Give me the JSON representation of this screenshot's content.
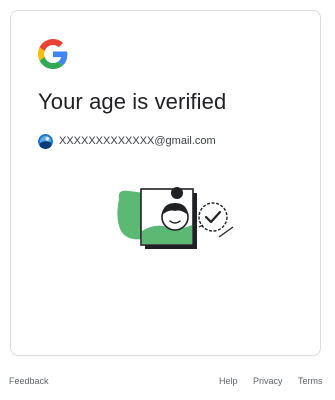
{
  "page": {
    "title": "Your age is verified"
  },
  "account": {
    "email": "XXXXXXXXXXXXX@gmail.com"
  },
  "footer": {
    "feedback": "Feedback",
    "help": "Help",
    "privacy": "Privacy",
    "terms": "Terms"
  },
  "icons": {
    "logo": "google-g-logo",
    "avatar": "account-avatar",
    "illustration": "age-verified-illustration"
  },
  "colors": {
    "google_blue": "#4285F4",
    "google_red": "#EA4335",
    "google_yellow": "#FBBC05",
    "google_green": "#34A853",
    "illustration_green": "#5bb974",
    "text_primary": "#202124",
    "text_secondary": "#5f6368"
  }
}
